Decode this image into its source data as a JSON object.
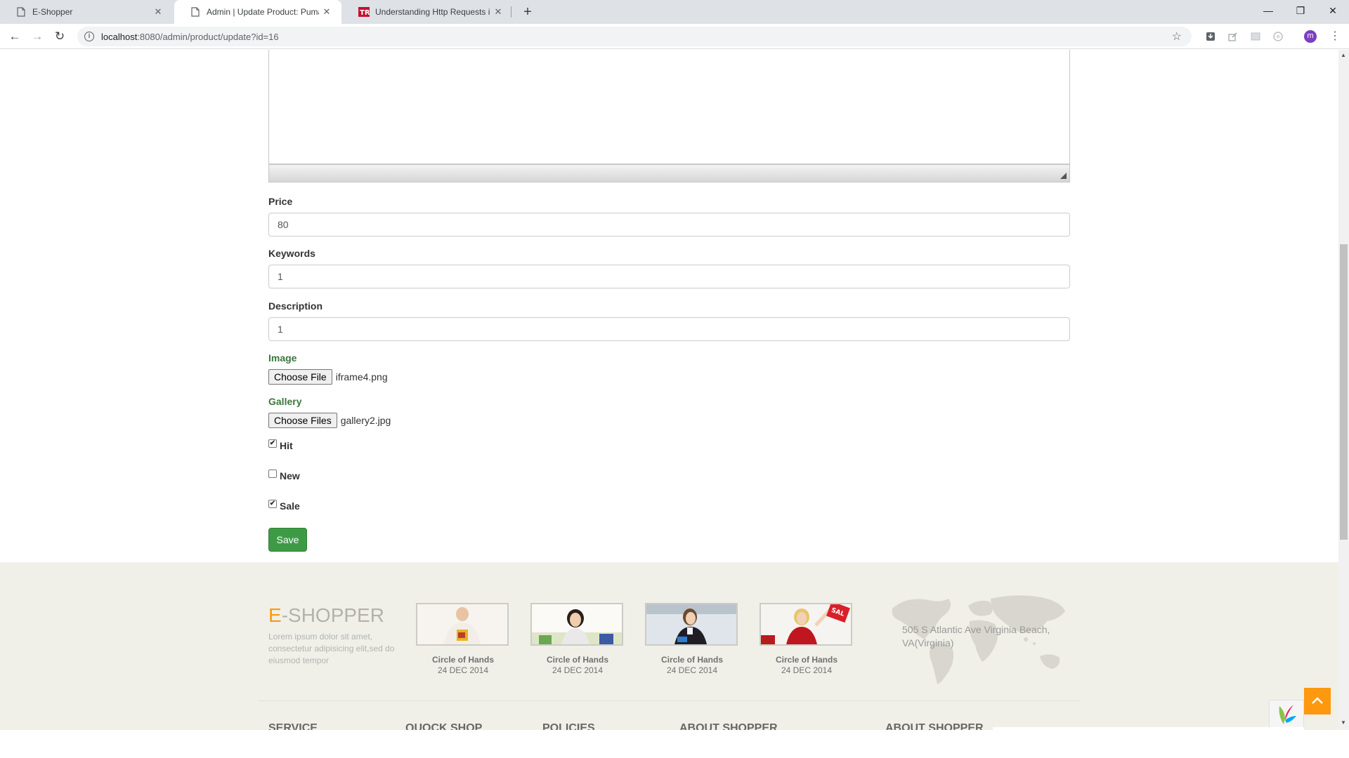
{
  "browser": {
    "tabs": [
      {
        "title": "E-Shopper",
        "active": false
      },
      {
        "title": "Admin | Update Product: Puma",
        "active": true
      },
      {
        "title": "Understanding Http Requests in",
        "active": false
      }
    ],
    "url_host": "localhost",
    "url_path": ":8080/admin/product/update?id=16",
    "profile_initial": "m"
  },
  "form": {
    "price_label": "Price",
    "price_value": "80",
    "keywords_label": "Keywords",
    "keywords_value": "1",
    "description_label": "Description",
    "description_value": "1",
    "image_label": "Image",
    "image_button": "Choose File",
    "image_file": "iframe4.png",
    "gallery_label": "Gallery",
    "gallery_button": "Choose Files",
    "gallery_file": "gallery2.jpg",
    "hit_label": "Hit",
    "hit_checked": true,
    "new_label": "New",
    "new_checked": false,
    "sale_label": "Sale",
    "sale_checked": true,
    "save_label": "Save"
  },
  "footer": {
    "brand_e": "E",
    "brand_rest": "-SHOPPER",
    "brand_text": "Lorem ipsum dolor sit amet, consectetur adipisicing elit,sed do eiusmod tempor",
    "videos": [
      {
        "title": "Circle of Hands",
        "date": "24 DEC 2014"
      },
      {
        "title": "Circle of Hands",
        "date": "24 DEC 2014"
      },
      {
        "title": "Circle of Hands",
        "date": "24 DEC 2014"
      },
      {
        "title": "Circle of Hands",
        "date": "24 DEC 2014"
      }
    ],
    "address": "505 S Atlantic Ave Virginia Beach, VA(Virginia)",
    "columns": [
      "SERVICE",
      "QUOCK SHOP",
      "POLICIES",
      "ABOUT SHOPPER",
      "ABOUT SHOPPER"
    ]
  },
  "colors": {
    "accent": "#fe980f",
    "save_button": "#3e9b45",
    "footer_bg": "#f0f0e9",
    "success_label": "#3c763d"
  }
}
